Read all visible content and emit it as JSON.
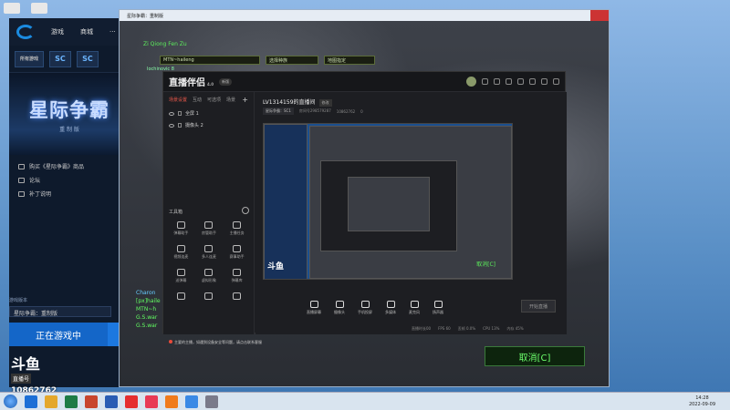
{
  "bnet": {
    "tabs": [
      "游戏",
      "商城"
    ],
    "more": "···",
    "all_games": "所有游戏",
    "game_sc2": "SC",
    "game_sc": "SC",
    "banner_title": "星际争霸",
    "banner_sub": "重 制 版",
    "links": [
      "购买《星际争霸》商品",
      "论坛",
      "补丁说明"
    ],
    "version_label": "游戏版本",
    "version_value": "星际争霸：重制版",
    "play_label": "正在游戏中"
  },
  "overlay": {
    "douyu_logo": "斗鱼",
    "douyu_tag": "直播号",
    "room_number": "10862762"
  },
  "sc2": {
    "window_title": "星际争霸：重制版",
    "player_name": "Zi Qiong Fen Zu",
    "input_name": "MTN~haileng",
    "input_race": "选择种族",
    "input_map": "地图指定",
    "status": "Iochinovic 8",
    "chat": [
      {
        "name": "Charon",
        "text": ""
      },
      {
        "name": "",
        "text": "[px]haile"
      },
      {
        "name": "",
        "text": "MTN~h"
      },
      {
        "name": "",
        "text": "G.S.war"
      },
      {
        "name": "",
        "text": "G.S.war"
      }
    ],
    "cancel": "取消[C]"
  },
  "live": {
    "logo": "直播伴侣",
    "version": "4.0",
    "badge": "新版",
    "scene_tabs": [
      "场景设置",
      "互动",
      "可选项",
      "场景"
    ],
    "scenes": [
      "全屏 1",
      "摄像头 2"
    ],
    "toolbox_title": "工具箱",
    "tools": [
      "弹幕助手",
      "房管助手",
      "主播任务",
      "视频连麦",
      "多人连麦",
      "赛事助手",
      "送弹幕",
      "虚拟形象",
      "弹幕库",
      "",
      "",
      ""
    ],
    "notice": "主要的主播，如遇到设备安全等问题，请点击联系客服",
    "room_title": "LV1314159的直播间",
    "room_tag": "修改",
    "room_category": "星际争霸：SC1",
    "room_id": "房间号298579287",
    "room_fans": "10862762",
    "room_hot": "0",
    "bar": [
      "直播屏幕",
      "摄像头",
      "手机投屏",
      "多媒体",
      "麦克风",
      "扬声器"
    ],
    "start_btn": "开始直播",
    "stats": [
      "直播时长00",
      "FPS 60",
      "丢帧 0.0%",
      "CPU 13%",
      "内存 45%",
      "关闭"
    ],
    "preview_cancel": "取消[C]",
    "preview_logo": "斗鱼"
  },
  "taskbar": {
    "time": "14:28",
    "date": "2022-09-09"
  },
  "colors": {
    "bnet_blue": "#1466c8",
    "sc2_green": "#6cff6c",
    "live_red": "#e8574a"
  }
}
